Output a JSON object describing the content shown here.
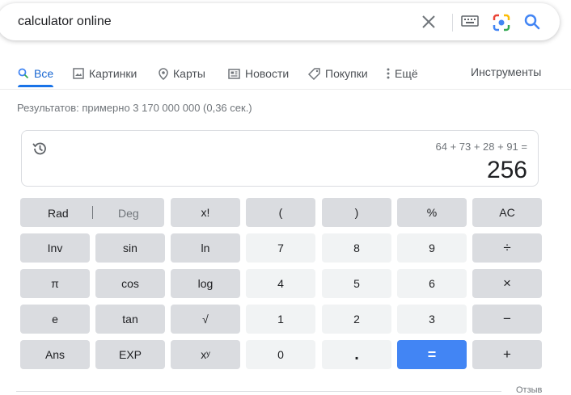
{
  "search": {
    "query": "calculator online"
  },
  "tabs": [
    {
      "label": "Все",
      "icon": "search-icon"
    },
    {
      "label": "Картинки",
      "icon": "image-icon"
    },
    {
      "label": "Карты",
      "icon": "pin-icon"
    },
    {
      "label": "Новости",
      "icon": "news-icon"
    },
    {
      "label": "Покупки",
      "icon": "tag-icon"
    },
    {
      "label": "Ещё",
      "icon": "more-icon"
    }
  ],
  "tools_label": "Инструменты",
  "results_count": "Результатов: примерно 3 170 000 000 (0,36 сек.)",
  "calculator": {
    "expression": "64 + 73 + 28 + 91 =",
    "result": "256",
    "rad": "Rad",
    "deg": "Deg",
    "keys": {
      "fact": "x!",
      "lparen": "(",
      "rparen": ")",
      "percent": "%",
      "ac": "AC",
      "inv": "Inv",
      "sin": "sin",
      "ln": "ln",
      "seven": "7",
      "eight": "8",
      "nine": "9",
      "divide": "÷",
      "pi": "π",
      "cos": "cos",
      "log": "log",
      "four": "4",
      "five": "5",
      "six": "6",
      "multiply": "×",
      "e": "e",
      "tan": "tan",
      "sqrt": "√",
      "one": "1",
      "two": "2",
      "three": "3",
      "minus": "−",
      "ans": "Ans",
      "exp": "EXP",
      "pow": "xʸ",
      "zero": "0",
      "dot": ".",
      "equals": "=",
      "plus": "+"
    }
  },
  "feedback_label": "Отзыв",
  "colors": {
    "accent": "#1a73e8",
    "equals": "#4285f4"
  }
}
